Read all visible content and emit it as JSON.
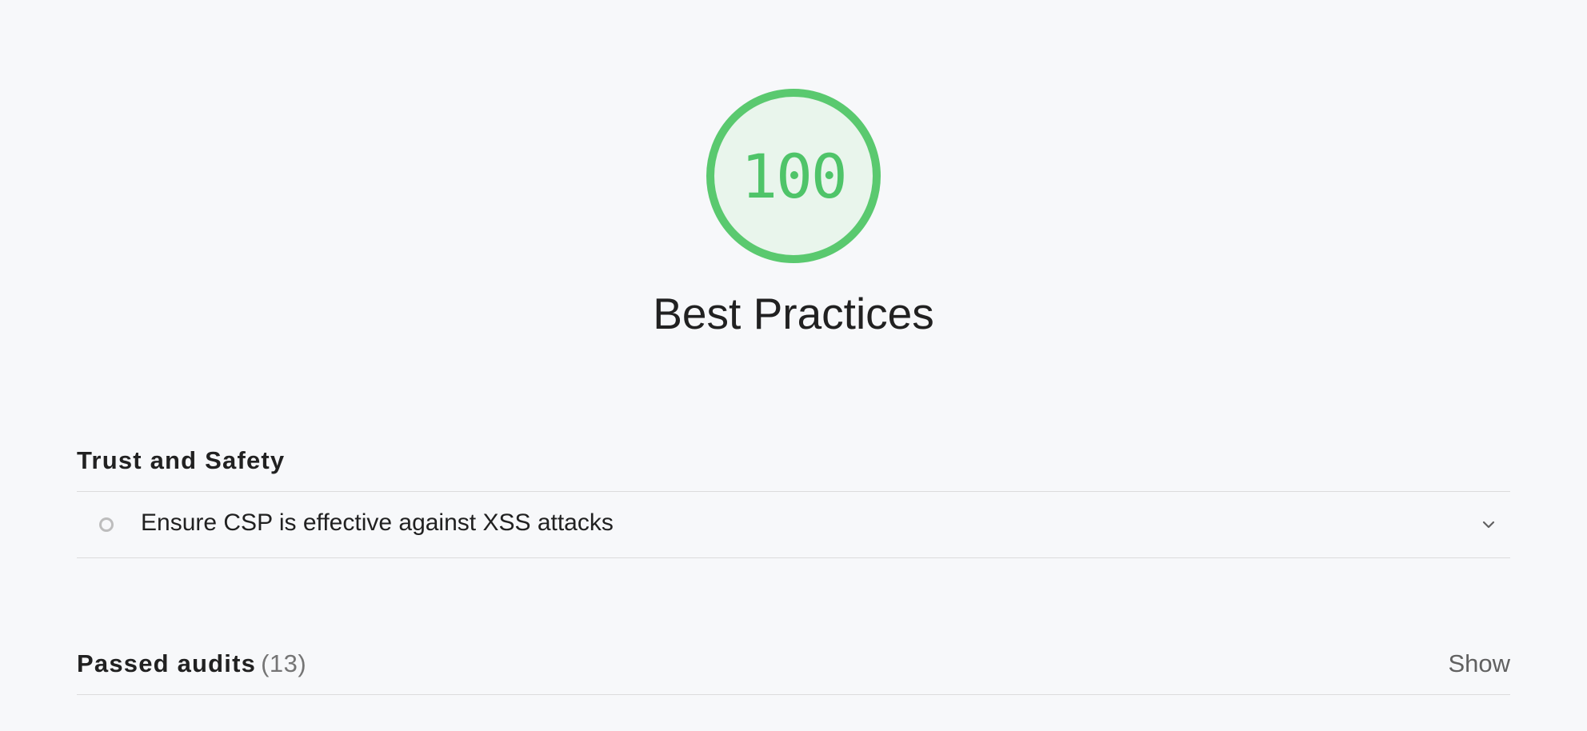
{
  "gauge": {
    "score": "100",
    "color": "#5ac96f",
    "fill_fraction": 1.0
  },
  "category": {
    "title": "Best Practices"
  },
  "groups": [
    {
      "title": "Trust and Safety",
      "audits": [
        {
          "title": "Ensure CSP is effective against XSS attacks",
          "status_icon": "informative-circle-icon",
          "expand_icon": "chevron-down-icon"
        }
      ]
    }
  ],
  "passed": {
    "title": "Passed audits",
    "count": "(13)",
    "toggle_label": "Show"
  }
}
